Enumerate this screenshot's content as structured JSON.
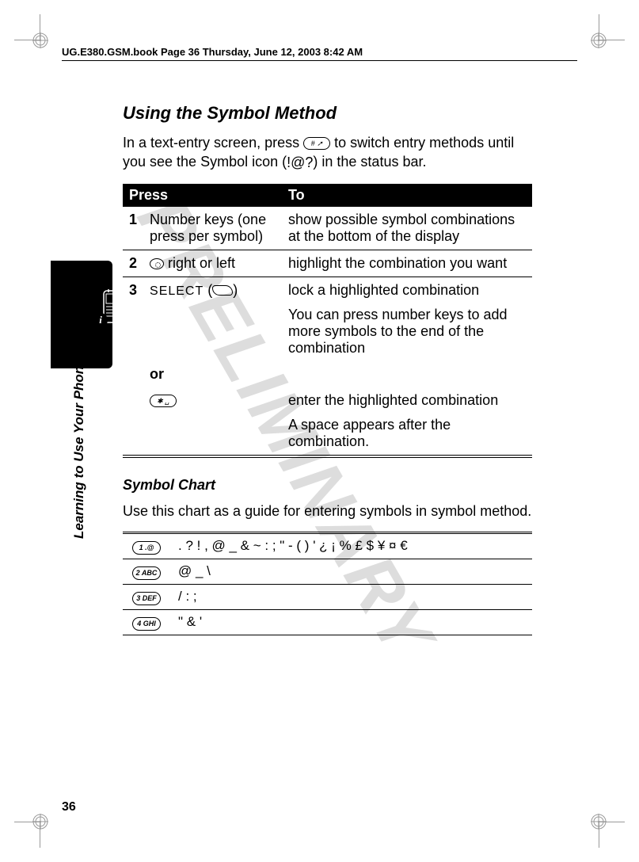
{
  "header": {
    "running_head": "UG.E380.GSM.book  Page 36  Thursday, June 12, 2003  8:42 AM"
  },
  "watermark": "PRELIMINARY",
  "sidebar_label": "Learning to Use Your Phone",
  "page_number": "36",
  "section_title": "Using the Symbol Method",
  "intro_text_before_key": "In a text-entry screen, press ",
  "intro_key_label": "#",
  "intro_text_after_key": " to switch entry methods until you see the Symbol icon (",
  "intro_icon_name": "symbol-icon",
  "intro_text_end": ") in the status bar.",
  "table": {
    "head_press": "Press",
    "head_to": "To",
    "rows": [
      {
        "num": "1",
        "press": "Number keys (one press per symbol)",
        "to": "show possible symbol combinations at the bottom of the display"
      },
      {
        "num": "2",
        "press_suffix": " right or left",
        "to": "highlight the combination you want"
      },
      {
        "num": "3",
        "select_label": "SELECT",
        "to_a": "lock a highlighted combination",
        "to_b": "You can press number keys to add more symbols to the end of the combination",
        "or_label": "or",
        "star_key": "*",
        "to_c": "enter the highlighted combination",
        "to_d": "A space appears after the combination."
      }
    ]
  },
  "subhead": "Symbol Chart",
  "subhead_text": "Use this chart as a guide for entering symbols in symbol method.",
  "symbol_rows": [
    {
      "key": "1 .@",
      "symbols": ". ? ! , @ _ & ~ : ; \" - ( ) ' ¿ ¡ % £ $ ¥ ¤ €"
    },
    {
      "key": "2 ABC",
      "symbols": "@ _ \\"
    },
    {
      "key": "3 DEF",
      "symbols": "/ : ;"
    },
    {
      "key": "4 GHI",
      "symbols": "\" & '"
    }
  ],
  "info_badge": "i"
}
